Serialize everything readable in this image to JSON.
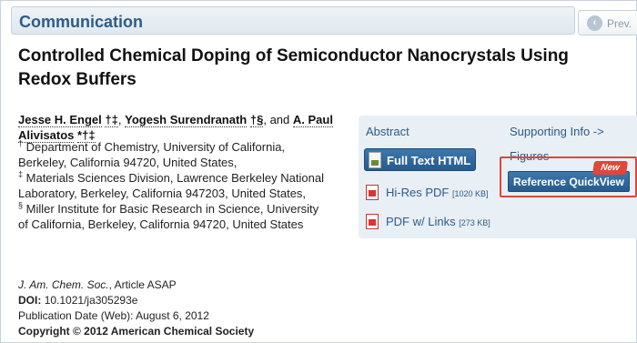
{
  "header": {
    "section": "Communication",
    "prev": "Prev."
  },
  "article": {
    "title": "Controlled Chemical Doping of Semiconductor Nanocrystals Using Redox Buffers",
    "authors": [
      {
        "name": "Jesse H. Engel",
        "marks": "†‡"
      },
      {
        "name": "Yogesh Surendranath",
        "marks": "†§"
      },
      {
        "name": "A. Paul Alivisatos",
        "marks": "*†‡"
      }
    ],
    "and": ", and",
    "affiliations": [
      {
        "mark": "†",
        "text": "Department of Chemistry, University of California, Berkeley, California 94720, United States,"
      },
      {
        "mark": "‡",
        "text": "Materials Sciences Division, Lawrence Berkeley National Laboratory, Berkeley, California 947203, United States,"
      },
      {
        "mark": "§",
        "text": "Miller Institute for Basic Research in Science, University of California, Berkeley, California 94720, United States"
      }
    ],
    "citation": {
      "journal": "J. Am. Chem. Soc.",
      "status": ", Article ASAP",
      "doi_label": "DOI:",
      "doi": "10.1021/ja305293e",
      "pub_date": "Publication Date (Web): August 6, 2012",
      "copyright": "Copyright © 2012 American Chemical Society"
    }
  },
  "panel": {
    "abstract": "Abstract",
    "supporting": "Supporting Info ->",
    "figures": "Figures",
    "full_text": "Full Text HTML",
    "hires_pdf": "Hi-Res PDF",
    "hires_size": "[1020 KB]",
    "pdf_links": "PDF w/ Links",
    "pdf_links_size": "[273 KB]",
    "reference_quickview": "Reference QuickView",
    "new_badge": "New"
  },
  "colors": {
    "link": "#2d5c86",
    "button": "#255b8e",
    "highlight": "#e0463a"
  }
}
